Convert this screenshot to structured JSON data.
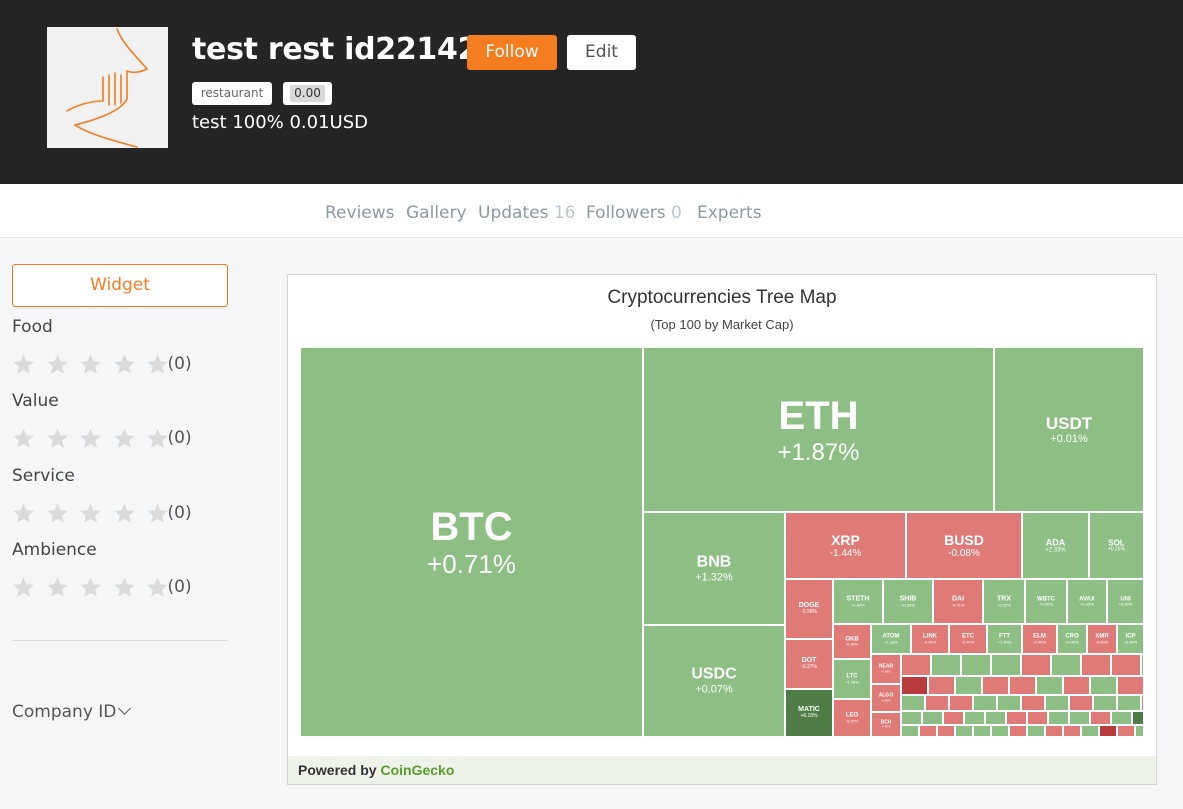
{
  "header": {
    "title": "test rest id221428",
    "follow_label": "Follow",
    "edit_label": "Edit",
    "category_tag": "restaurant",
    "rating_tag": "0.00",
    "subline": "test 100% 0.01USD"
  },
  "tabs": [
    {
      "label": "Reviews",
      "count": ""
    },
    {
      "label": "Gallery",
      "count": ""
    },
    {
      "label": "Updates",
      "count": "16"
    },
    {
      "label": "Followers",
      "count": "0"
    },
    {
      "label": "Experts",
      "count": ""
    }
  ],
  "sidebar": {
    "widget_label": "Widget",
    "ratings": [
      {
        "label": "Food",
        "count": "(0)"
      },
      {
        "label": "Value",
        "count": "(0)"
      },
      {
        "label": "Service",
        "count": "(0)"
      },
      {
        "label": "Ambience",
        "count": "(0)"
      }
    ],
    "company_id_label": "Company ID"
  },
  "treemap": {
    "title": "Cryptocurrencies Tree Map",
    "subtitle": "(Top 100 by Market Cap)",
    "footer_prefix": "Powered by ",
    "footer_brand": "CoinGecko"
  },
  "colors": {
    "accent": "#f57c1f",
    "dark_header": "#252525",
    "up": "#8dbf84",
    "down": "#e07a76",
    "strong_up": "#4f7d45",
    "strong_down": "#b83a3a"
  },
  "chart_data": {
    "type": "treemap",
    "title": "Cryptocurrencies Tree Map",
    "subtitle": "(Top 100 by Market Cap)",
    "items": [
      {
        "symbol": "BTC",
        "change": "+0.71%"
      },
      {
        "symbol": "ETH",
        "change": "+1.87%"
      },
      {
        "symbol": "USDT",
        "change": "+0.01%"
      },
      {
        "symbol": "BNB",
        "change": "+1.32%"
      },
      {
        "symbol": "USDC",
        "change": "+0.07%"
      },
      {
        "symbol": "XRP",
        "change": "-1.44%"
      },
      {
        "symbol": "BUSD",
        "change": "-0.08%"
      },
      {
        "symbol": "ADA",
        "change": "+2.33%"
      },
      {
        "symbol": "SOL",
        "change": "+0.26%"
      },
      {
        "symbol": "DOGE",
        "change": "-0.98%"
      },
      {
        "symbol": "STETH",
        "change": "+1.84%"
      },
      {
        "symbol": "SHIB",
        "change": "+0.60%"
      },
      {
        "symbol": "DAI",
        "change": "-0.01%"
      },
      {
        "symbol": "TRX",
        "change": "+0.23%"
      },
      {
        "symbol": "WBTC",
        "change": "+0.60%"
      },
      {
        "symbol": "AVAX",
        "change": "+1.05%"
      },
      {
        "symbol": "UNI",
        "change": "+0.50%"
      },
      {
        "symbol": "DOT",
        "change": "-0.37%"
      },
      {
        "symbol": "OKB",
        "change": "-0.36%"
      },
      {
        "symbol": "ATOM",
        "change": "+1.18%"
      },
      {
        "symbol": "LINK",
        "change": "-0.40%"
      },
      {
        "symbol": "ETC",
        "change": "-0.47%"
      },
      {
        "symbol": "FTT",
        "change": "+1.40%"
      },
      {
        "symbol": "ELM",
        "change": "-0.40%"
      },
      {
        "symbol": "CRO",
        "change": "+0.40%"
      },
      {
        "symbol": "XMR",
        "change": "-0.50%"
      },
      {
        "symbol": "ICP",
        "change": "+0.80%"
      },
      {
        "symbol": "LTC",
        "change": "+1.28%"
      },
      {
        "symbol": "MATIC",
        "change": "+6.18%"
      },
      {
        "symbol": "LEO",
        "change": "-0.37%"
      },
      {
        "symbol": "NEAR",
        "change": "-0.60%"
      },
      {
        "symbol": "ALGO",
        "change": "-0.50%"
      },
      {
        "symbol": "BCH",
        "change": "-0.40%"
      }
    ]
  }
}
